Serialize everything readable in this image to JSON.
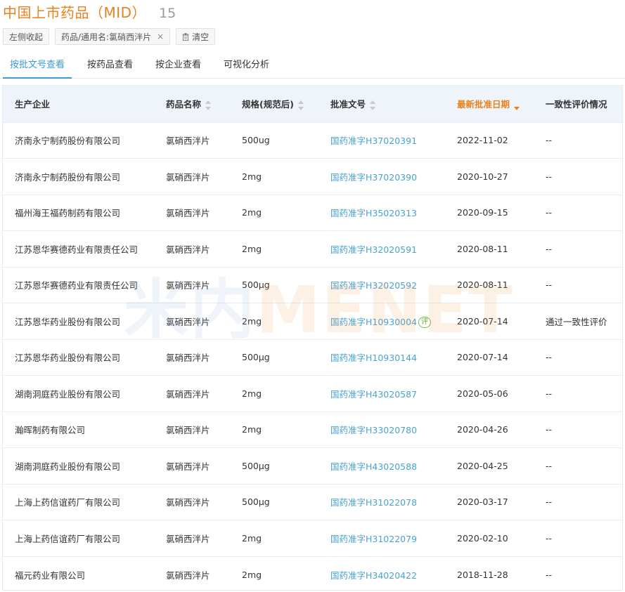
{
  "header": {
    "title": "中国上市药品（MID）",
    "count": "15"
  },
  "filters": {
    "collapse_label": "左侧收起",
    "active_filter": "药品/通用名:氯硝西泮片",
    "remove_symbol": "×",
    "clear_label": "清空"
  },
  "tabs": [
    {
      "label": "按批文号查看",
      "active": true
    },
    {
      "label": "按药品查看",
      "active": false
    },
    {
      "label": "按企业查看",
      "active": false
    },
    {
      "label": "可视化分析",
      "active": false
    }
  ],
  "table": {
    "columns": [
      {
        "label": "生产企业"
      },
      {
        "label": "药品名称"
      },
      {
        "label": "规格(规范后)"
      },
      {
        "label": "批准文号"
      },
      {
        "label": "最新批准日期"
      },
      {
        "label": "一致性评价情况"
      }
    ],
    "rows": [
      {
        "company": "济南永宁制药股份有限公司",
        "drug": "氯硝西泮片",
        "spec": "500ug",
        "approval": "国药准字H37020391",
        "badge": "",
        "date": "2022-11-02",
        "consistency": "--"
      },
      {
        "company": "济南永宁制药股份有限公司",
        "drug": "氯硝西泮片",
        "spec": "2mg",
        "approval": "国药准字H37020390",
        "badge": "",
        "date": "2020-10-27",
        "consistency": "--"
      },
      {
        "company": "福州海王福药制药有限公司",
        "drug": "氯硝西泮片",
        "spec": "2mg",
        "approval": "国药准字H35020313",
        "badge": "",
        "date": "2020-09-15",
        "consistency": "--"
      },
      {
        "company": "江苏恩华赛德药业有限责任公司",
        "drug": "氯硝西泮片",
        "spec": "2mg",
        "approval": "国药准字H32020591",
        "badge": "",
        "date": "2020-08-11",
        "consistency": "--"
      },
      {
        "company": "江苏恩华赛德药业有限责任公司",
        "drug": "氯硝西泮片",
        "spec": "500μg",
        "approval": "国药准字H32020592",
        "badge": "",
        "date": "2020-08-11",
        "consistency": "--"
      },
      {
        "company": "江苏恩华药业股份有限公司",
        "drug": "氯硝西泮片",
        "spec": "2mg",
        "approval": "国药准字H10930004",
        "badge": "评",
        "date": "2020-07-14",
        "consistency": "通过一致性评价"
      },
      {
        "company": "江苏恩华药业股份有限公司",
        "drug": "氯硝西泮片",
        "spec": "500μg",
        "approval": "国药准字H10930144",
        "badge": "",
        "date": "2020-07-14",
        "consistency": "--"
      },
      {
        "company": "湖南洞庭药业股份有限公司",
        "drug": "氯硝西泮片",
        "spec": "2mg",
        "approval": "国药准字H43020587",
        "badge": "",
        "date": "2020-05-06",
        "consistency": "--"
      },
      {
        "company": "瀚晖制药有限公司",
        "drug": "氯硝西泮片",
        "spec": "2mg",
        "approval": "国药准字H33020780",
        "badge": "",
        "date": "2020-04-26",
        "consistency": "--"
      },
      {
        "company": "湖南洞庭药业股份有限公司",
        "drug": "氯硝西泮片",
        "spec": "500μg",
        "approval": "国药准字H43020588",
        "badge": "",
        "date": "2020-04-25",
        "consistency": "--"
      },
      {
        "company": "上海上药信谊药厂有限公司",
        "drug": "氯硝西泮片",
        "spec": "500μg",
        "approval": "国药准字H31022078",
        "badge": "",
        "date": "2020-03-17",
        "consistency": "--"
      },
      {
        "company": "上海上药信谊药厂有限公司",
        "drug": "氯硝西泮片",
        "spec": "2mg",
        "approval": "国药准字H31022079",
        "badge": "",
        "date": "2020-02-10",
        "consistency": "--"
      },
      {
        "company": "福元药业有限公司",
        "drug": "氯硝西泮片",
        "spec": "2mg",
        "approval": "国药准字H34020422",
        "badge": "",
        "date": "2018-11-28",
        "consistency": "--"
      }
    ]
  },
  "watermark": {
    "cn": "米内",
    "en": "MENET"
  },
  "colors": {
    "title": "#e8821e",
    "link": "#4aa3cf",
    "active_tab": "#3a9bd5",
    "header_bg": "#eef4fa",
    "badge": "#6aaf3a"
  }
}
